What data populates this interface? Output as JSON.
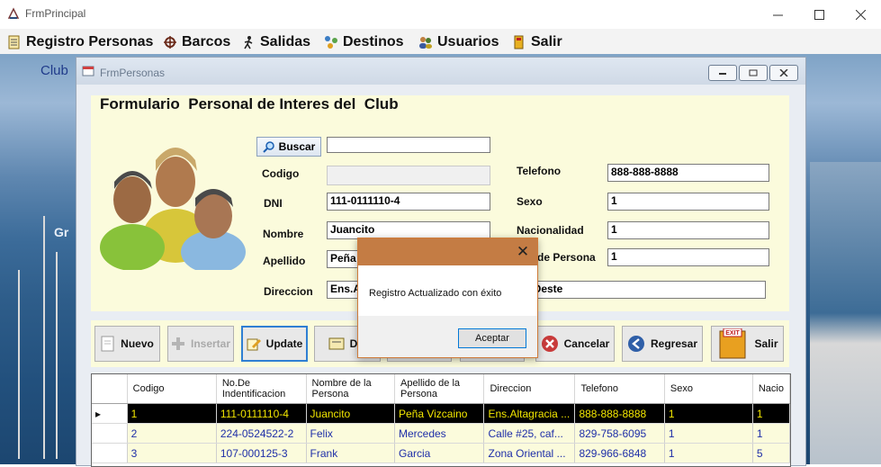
{
  "window": {
    "title": "FrmPrincipal"
  },
  "menu": [
    {
      "label": "Registro Personas",
      "icon": "notepad-icon"
    },
    {
      "label": "Barcos",
      "icon": "ship-wheel-icon"
    },
    {
      "label": "Salidas",
      "icon": "person-walking-icon"
    },
    {
      "label": "Destinos",
      "icon": "network-icon"
    },
    {
      "label": "Usuarios",
      "icon": "users-icon"
    },
    {
      "label": "Salir",
      "icon": "exit-door-icon"
    }
  ],
  "background": {
    "club_text": "Club",
    "gr_text": "Gr"
  },
  "child": {
    "title": "FrmPersonas",
    "form_title": "Formulario  Personal de Interes del  Club",
    "search": {
      "button_label": "Buscar",
      "value": ""
    },
    "fields": {
      "codigo": {
        "label": "Codigo",
        "value": ""
      },
      "dni": {
        "label": "DNI",
        "value": "111-0111110-4"
      },
      "nombre": {
        "label": "Nombre",
        "value": "Juancito"
      },
      "apellido": {
        "label": "Apellido",
        "value": "Peña"
      },
      "direccion": {
        "label": "Direccion",
        "value": "Ens.A"
      },
      "telefono": {
        "label": "Telefono",
        "value": "888-888-8888"
      },
      "sexo": {
        "label": "Sexo",
        "value": "1"
      },
      "nacionalidad": {
        "label": "Nacionalidad",
        "value": "1"
      },
      "tipo": {
        "label": "de Persona",
        "value": "1"
      },
      "direccion_right": {
        "value": "Oeste"
      }
    },
    "toolbar": {
      "nuevo": "Nuevo",
      "insertar": "Insertar",
      "update": "Update",
      "delete": "Del",
      "cancelar": "Cancelar",
      "regresar": "Regresar",
      "salir": "Salir",
      "exit_sign": "EXIT"
    },
    "grid": {
      "columns": [
        "Codigo",
        "No.De Indentificacion",
        "Nombre de la Persona",
        "Apellido de la Persona",
        "Direccion",
        "Telefono",
        "Sexo",
        "Nacio"
      ],
      "rows": [
        [
          "1",
          "111-0111110-4",
          "Juancito",
          "Peña Vizcaino",
          "Ens.Altagracia ...",
          "888-888-8888",
          "1",
          "1"
        ],
        [
          "2",
          "224-0524522-2",
          "Felix",
          "Mercedes",
          "Calle #25, caf...",
          "829-758-6095",
          "1",
          "1"
        ],
        [
          "3",
          "107-000125-3",
          "Frank",
          "Garcia",
          "Zona Oriental ...",
          "829-966-6848",
          "1",
          "5"
        ]
      ],
      "row_indicator": "▸"
    }
  },
  "dialog": {
    "close": "✕",
    "message": "Registro Actualizado con éxito",
    "ok": "Aceptar"
  },
  "colors": {
    "dialog_title": "#c47c44",
    "panel": "#fbfbdc",
    "selected_text": "#f2e600"
  }
}
